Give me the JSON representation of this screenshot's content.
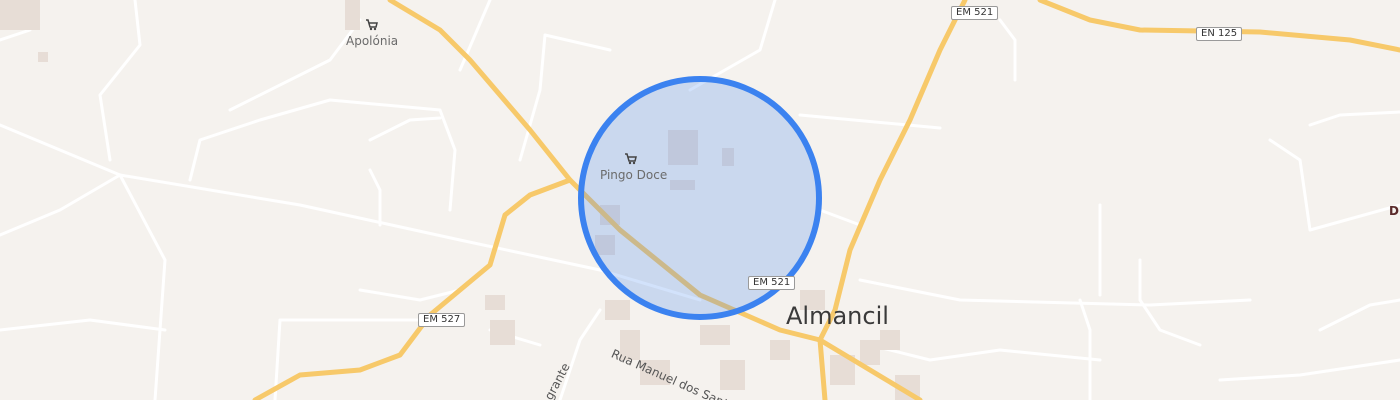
{
  "map": {
    "colors": {
      "background": "#f5f2ee",
      "minor_road": "#ffffff",
      "major_road": "#f7c96a",
      "building": "#e7ddd6",
      "accuracy_fill": "#4b8df0",
      "accuracy_stroke": "#3b82f0"
    },
    "places": {
      "apolonia": "Apolónia",
      "pingo_doce": "Pingo Doce",
      "almancil": "Almancil",
      "edge_label": "D"
    },
    "road_shields": {
      "em521_top": "EM 521",
      "en125": "EN 125",
      "em527": "EM 527",
      "em521_mid": "EM 521"
    },
    "streets": {
      "rua_manuel": "Rua Manuel dos Santos",
      "partial": "grante"
    },
    "icons": [
      "shopping-cart-icon",
      "shopping-cart-icon",
      "location-accuracy-circle"
    ]
  }
}
